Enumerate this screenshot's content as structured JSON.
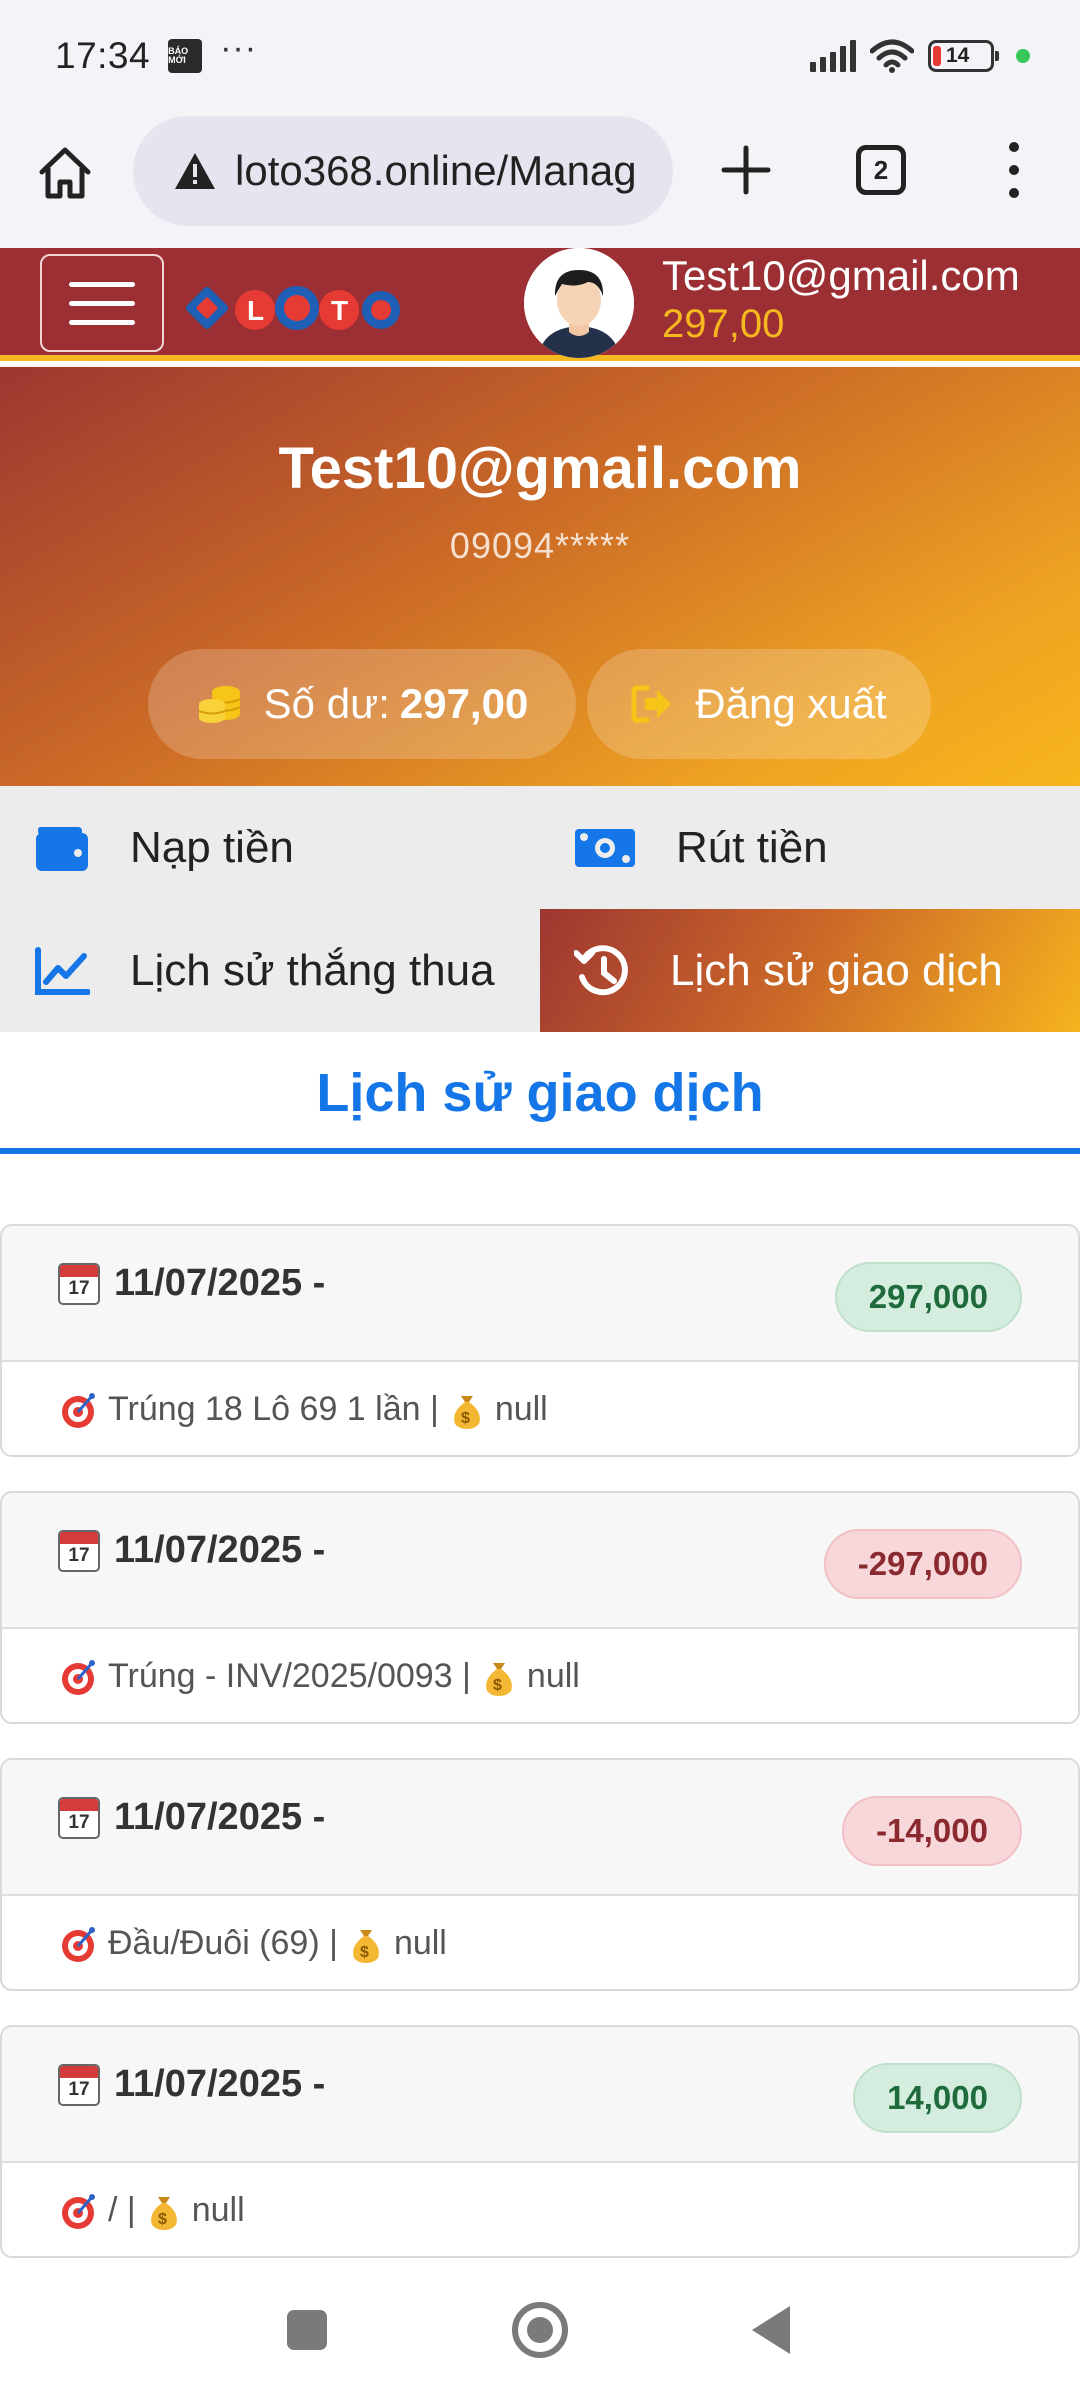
{
  "status_bar": {
    "time": "17:34",
    "notification_icon": "baomoi-icon",
    "notification_icon_text": "BÁO MỚI",
    "more": "···",
    "battery": "14",
    "icons": [
      "signal-icon",
      "wifi-icon",
      "battery-icon",
      "green-dot"
    ]
  },
  "browser": {
    "url": "loto368.online/Manag",
    "tab_count": "2",
    "icons": [
      "home-icon",
      "warning-icon",
      "plus-icon",
      "tabs-icon",
      "kebab-icon"
    ]
  },
  "header": {
    "logo_text": "LOTO",
    "email": "Test10@gmail.com",
    "balance": "297,00"
  },
  "profile": {
    "email": "Test10@gmail.com",
    "phone": "09094*****",
    "balance_label": "Số dư:",
    "balance_value": "297,00",
    "logout_label": "Đăng xuất"
  },
  "menu": [
    {
      "label": "Nạp tiền",
      "icon": "wallet-icon",
      "active": false
    },
    {
      "label": "Rút tiền",
      "icon": "money-icon",
      "active": false
    },
    {
      "label": "Lịch sử thắng thua",
      "icon": "chart-line-icon",
      "active": false
    },
    {
      "label": "Lịch sử giao dịch",
      "icon": "history-icon",
      "active": true
    }
  ],
  "section_title": "Lịch sử giao dịch",
  "transactions": [
    {
      "date": "11/07/2025 -",
      "amount": "297,000",
      "type": "positive",
      "desc": "Trúng 18 Lô 69 1 lần |",
      "note": "null"
    },
    {
      "date": "11/07/2025 -",
      "amount": "-297,000",
      "type": "negative",
      "desc": "Trúng - INV/2025/0093 |",
      "note": "null"
    },
    {
      "date": "11/07/2025 -",
      "amount": "-14,000",
      "type": "negative",
      "desc": "Đầu/Đuôi (69) |",
      "note": "null"
    },
    {
      "date": "11/07/2025 -",
      "amount": "14,000",
      "type": "positive",
      "desc": "/ |",
      "note": "null"
    }
  ],
  "calendar_icon_text": "17",
  "colors": {
    "header_bg": "#9c2f33",
    "accent_yellow": "#f6b81f",
    "link_blue": "#1576e8",
    "badge_positive_bg": "#d4eddf",
    "badge_negative_bg": "#f8d7da"
  }
}
